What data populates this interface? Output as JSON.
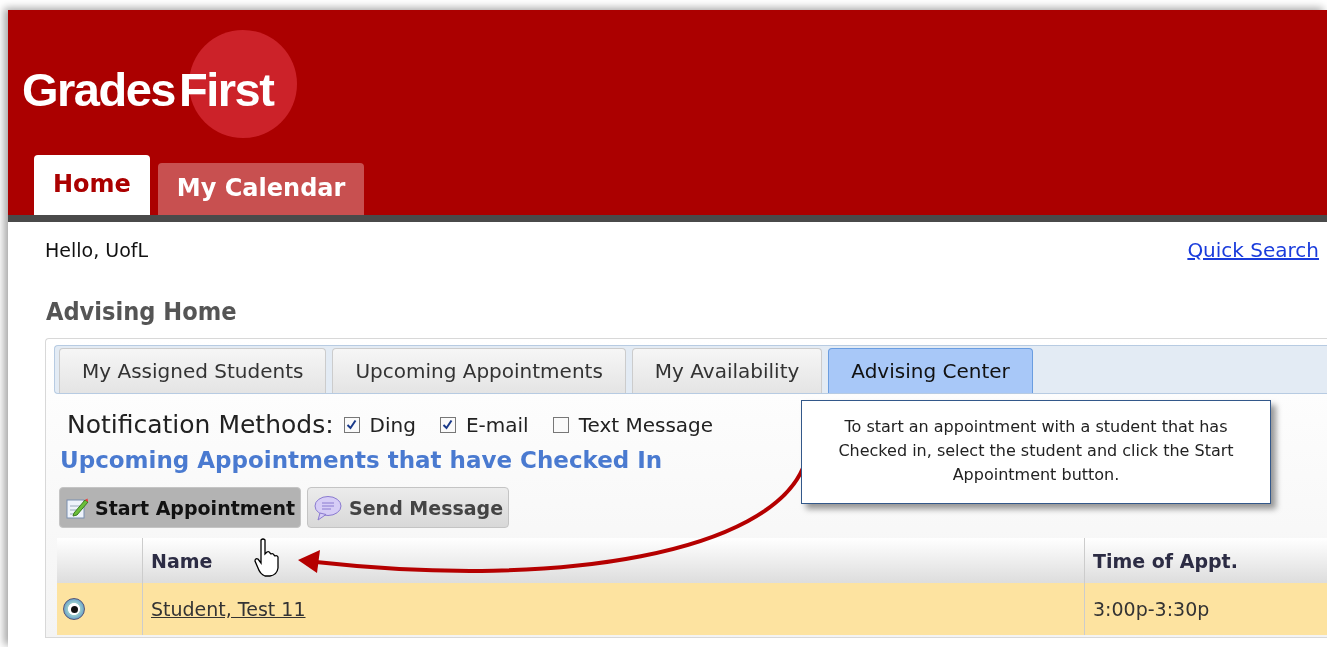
{
  "logo": {
    "word_1": "Grades",
    "word_2": "First"
  },
  "main_tabs": [
    {
      "label": "Home",
      "selected": true
    },
    {
      "label": "My Calendar",
      "selected": false
    }
  ],
  "greeting": "Hello, UofL",
  "quick_search": "Quick Search",
  "page_title": "Advising Home",
  "tabs": [
    {
      "label": "My Assigned Students",
      "selected": false
    },
    {
      "label": "Upcoming Appointments",
      "selected": false
    },
    {
      "label": "My Availability",
      "selected": false
    },
    {
      "label": "Advising Center",
      "selected": true
    }
  ],
  "notification_methods": {
    "label": "Notification Methods:",
    "options": [
      {
        "label": "Ding",
        "checked": true
      },
      {
        "label": "E-mail",
        "checked": true
      },
      {
        "label": "Text Message",
        "checked": false
      }
    ]
  },
  "section_title": "Upcoming Appointments that have Checked In",
  "toolbar": [
    {
      "kind": "start",
      "label": "Start Appointment",
      "hovered": true
    },
    {
      "kind": "message",
      "label": "Send Message",
      "hovered": false
    }
  ],
  "table": {
    "columns": [
      "Name",
      "Time of Appt."
    ],
    "rows": [
      {
        "selected": true,
        "name": "Student, Test 11",
        "time": "3:00p-3:30p"
      }
    ]
  },
  "callout": {
    "text": "To start an appointment with a student that has Checked in, select the student and click the Start Appointment button."
  }
}
